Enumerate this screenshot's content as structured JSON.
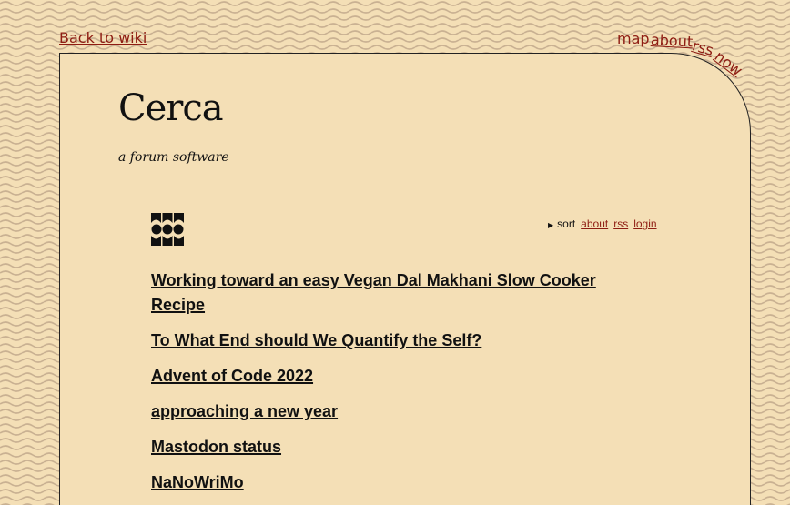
{
  "header_links": {
    "back_label": "Back to wiki",
    "map_label": "map",
    "about_label": "about",
    "rss_label": "rss",
    "now_label": "now"
  },
  "site": {
    "title": "Cerca",
    "subtitle": "a forum software"
  },
  "toolbar": {
    "sort_label": "sort",
    "about_label": "about",
    "rss_label": "rss",
    "login_label": "login"
  },
  "threads": [
    "Working toward an easy Vegan Dal Makhani Slow Cooker Recipe",
    "To What End should We Quantify the Self?",
    "Advent of Code 2022",
    "approaching a new year",
    "Mastodon status",
    "NaNoWriMo"
  ],
  "colors": {
    "background": "#f4dfb6",
    "link": "#8e1c12",
    "text": "#111111",
    "wave": "#c9b192"
  },
  "icons": {
    "logo": "cerca-logo-icon",
    "sort_caret": "caret-right-icon"
  }
}
